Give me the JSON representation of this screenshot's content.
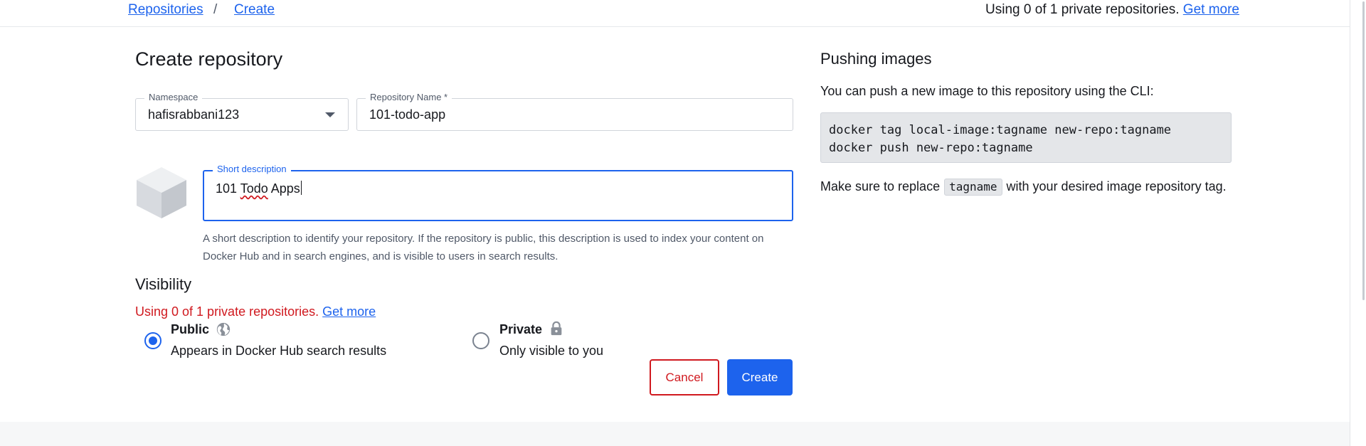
{
  "breadcrumb": {
    "items": [
      "Repositories",
      "Create"
    ],
    "separator": "/"
  },
  "top_usage": {
    "text": "Using 0 of 1 private repositories.",
    "link": "Get more"
  },
  "form": {
    "title": "Create repository",
    "namespace": {
      "label": "Namespace",
      "value": "hafisrabbani123"
    },
    "repo_name": {
      "label": "Repository Name *",
      "value": "101-todo-app"
    },
    "short_description": {
      "label": "Short description",
      "value_prefix": "101 ",
      "value_misspelled": "Todo",
      "value_suffix": " Apps",
      "helper": "A short description to identify your repository. If the repository is public, this description is used to index your content on Docker Hub and in search engines, and is visible to users in search results."
    },
    "visibility": {
      "title": "Visibility",
      "usage_text": "Using 0 of 1 private repositories.",
      "usage_link": "Get more",
      "options": [
        {
          "title": "Public",
          "description": "Appears in Docker Hub search results",
          "icon": "globe-icon",
          "selected": true
        },
        {
          "title": "Private",
          "description": "Only visible to you",
          "icon": "lock-icon",
          "selected": false
        }
      ]
    },
    "cancel_label": "Cancel",
    "create_label": "Create"
  },
  "pushing": {
    "title": "Pushing images",
    "description": "You can push a new image to this repository using the CLI:",
    "code_lines": [
      "docker tag local-image:tagname new-repo:tagname",
      "docker push new-repo:tagname"
    ],
    "note_before": "Make sure to replace",
    "note_code": "tagname",
    "note_after": "with your desired image repository tag."
  },
  "colors": {
    "accent": "#1d63ed",
    "danger": "#d0191f",
    "text": "#17191e",
    "muted": "#505968"
  }
}
